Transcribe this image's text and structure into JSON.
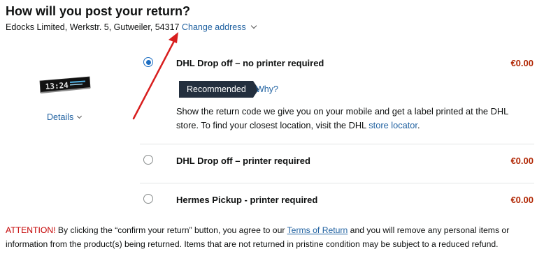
{
  "header": {
    "title": "How will you post your return?",
    "address": "Edocks Limited, Werkstr. 5, Gutweiler, 54317",
    "change_address": "Change address"
  },
  "product": {
    "image_icon": "digital-clock-product-image",
    "clock_display": "13:24",
    "details_label": "Details"
  },
  "options": [
    {
      "label": "DHL Drop off – no printer required",
      "price": "€0.00",
      "selected": true,
      "badge": "Recommended",
      "why": "Why?",
      "description_prefix": "Show the return code we give you on your mobile and get a label printed at the DHL store. To find your closest location, visit the DHL",
      "description_link": "store locator",
      "description_suffix": "."
    },
    {
      "label": "DHL Drop off – printer required",
      "price": "€0.00",
      "selected": false
    },
    {
      "label": "Hermes Pickup - printer required",
      "price": "€0.00",
      "selected": false
    }
  ],
  "footer": {
    "attention_label": "ATTENTION!",
    "text_1": " By clicking the “confirm your return” button, you agree to our ",
    "terms_link": "Terms of Return",
    "text_2": " and you will remove any personal items or information from the product(s) being returned. Items that are not returned in pristine condition may be subject to a reduced refund."
  },
  "colors": {
    "link": "#2162a1",
    "price": "#b12704",
    "badge_bg": "#232f3e",
    "attention": "#c40000",
    "annotation_arrow": "#d81e1e"
  }
}
